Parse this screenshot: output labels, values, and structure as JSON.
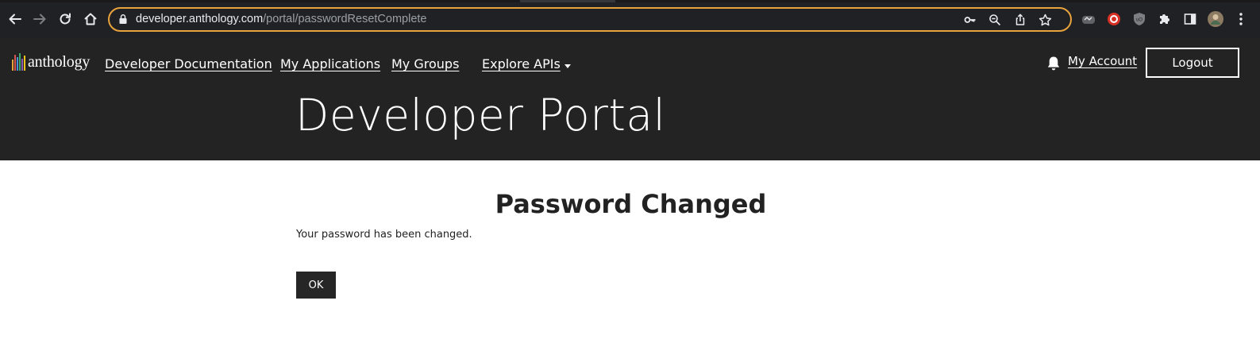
{
  "browser": {
    "url_host": "developer.anthology.com",
    "url_path": "/portal/passwordResetComplete"
  },
  "header": {
    "logo_text": "anthology",
    "nav": {
      "developer_documentation": "Developer Documentation",
      "my_applications": "My Applications",
      "my_groups": "My Groups",
      "explore_apis": "Explore APIs"
    },
    "my_account": "My Account",
    "logout": "Logout",
    "portal_title": "Developer Portal",
    "logo_bar_colors": [
      "#e8a33d",
      "#d9534f",
      "#4a90d9",
      "#3fae6b",
      "#8e5bb5",
      "#f0c419"
    ]
  },
  "main": {
    "heading": "Password Changed",
    "message": "Your password has been changed.",
    "ok_button": "OK"
  },
  "colors": {
    "header_bg": "#232323",
    "chrome_bg": "#202124",
    "omnibox_focus": "#e8a33d",
    "button_bg": "#262626"
  }
}
